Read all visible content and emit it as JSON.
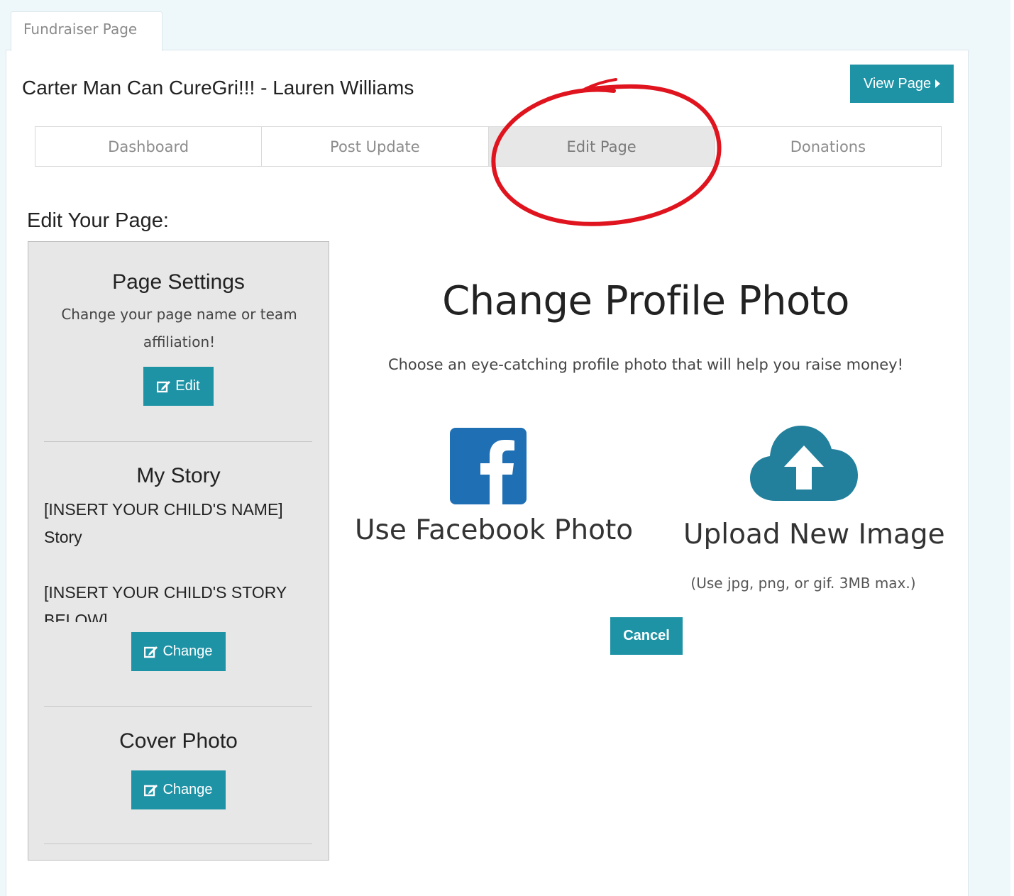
{
  "window_tab": "Fundraiser Page",
  "page_title": "Carter Man Can CureGri!!! - Lauren Williams",
  "view_button": "View Page",
  "subnav": [
    "Dashboard",
    "Post Update",
    "Edit Page",
    "Donations"
  ],
  "active_subnav": "Edit Page",
  "edit_heading": "Edit Your Page:",
  "sidebar": {
    "page_settings": {
      "title": "Page Settings",
      "text": "Change your page name or team affiliation!",
      "button": "Edit"
    },
    "my_story": {
      "title": "My Story",
      "lines": [
        "[INSERT YOUR CHILD'S NAME]",
        "Story",
        "",
        "[INSERT YOUR CHILD'S STORY",
        "BELOW]"
      ],
      "button": "Change"
    },
    "cover_photo": {
      "title": "Cover Photo",
      "button": "Change"
    }
  },
  "main": {
    "title": "Change Profile Photo",
    "subtitle": "Choose an eye-catching profile photo that will help you raise money!",
    "facebook_label": "Use Facebook Photo",
    "upload_label": "Upload New Image",
    "upload_hint": "(Use jpg, png, or gif. 3MB max.)",
    "cancel_button": "Cancel"
  },
  "colors": {
    "accent": "#1f93a6",
    "facebook": "#1f6fb5",
    "annotation": "#e0141e",
    "sidebar_bg": "#e7e7e7"
  },
  "icons": [
    "facebook-icon",
    "cloud-upload-icon",
    "edit-icon",
    "caret-right-icon"
  ]
}
